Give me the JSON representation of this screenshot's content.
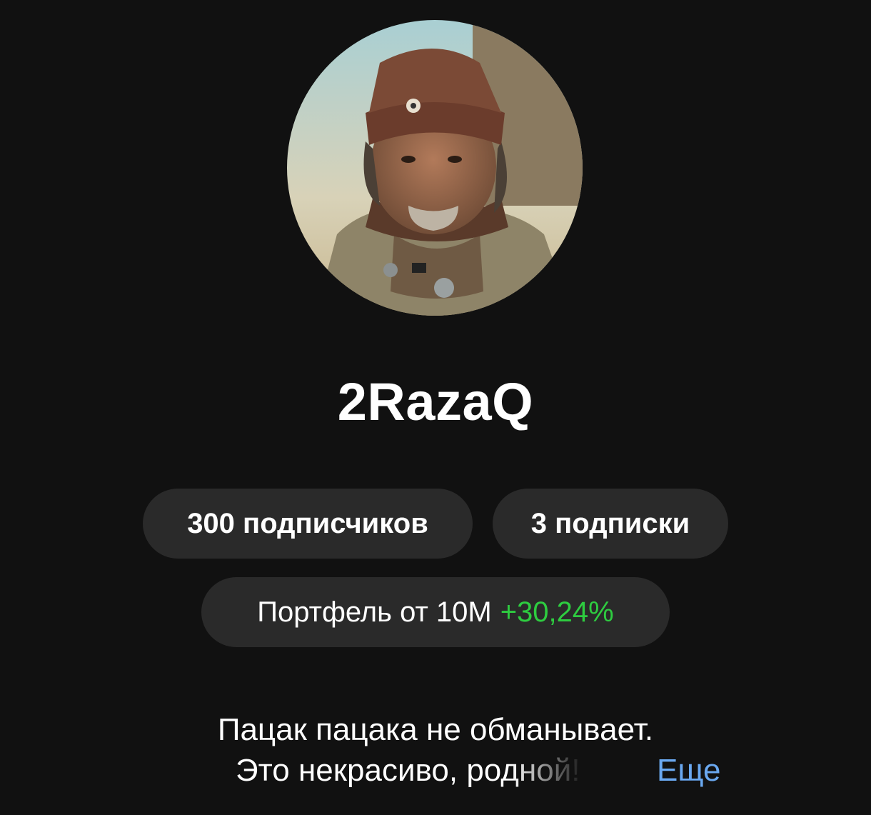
{
  "profile": {
    "username": "2RazaQ",
    "avatar_icon": "profile-photo"
  },
  "stats": {
    "followers_label": "300 подписчиков",
    "following_label": "3 подписки"
  },
  "portfolio": {
    "label": "Портфель от 10М",
    "gain": "+30,24%",
    "gain_color": "#2ecc40"
  },
  "bio": {
    "line1": "Пацак пацака не обманывает.",
    "line2": "Это некрасиво, родной!",
    "more_label": "Еще",
    "more_color": "#6aa8f0"
  },
  "theme": {
    "background": "#111111",
    "pill_background": "#2a2a2a"
  }
}
